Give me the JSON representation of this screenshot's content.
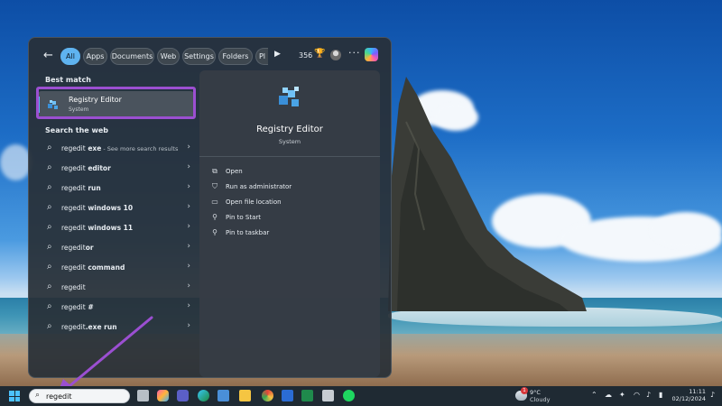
{
  "filter_bar": {
    "chips": [
      "All",
      "Apps",
      "Documents",
      "Web",
      "Settings",
      "Folders",
      "Pl"
    ],
    "active": "All",
    "points": "356"
  },
  "best_match": {
    "heading": "Best match",
    "title": "Registry Editor",
    "subtitle": "System"
  },
  "web": {
    "heading": "Search the web",
    "items": [
      {
        "prefix": "regedit",
        "suffix": " exe",
        "extra": " - See more search results"
      },
      {
        "prefix": "regedit",
        "suffix": " editor",
        "extra": ""
      },
      {
        "prefix": "regedit",
        "suffix": " run",
        "extra": ""
      },
      {
        "prefix": "regedit",
        "suffix": " windows 10",
        "extra": ""
      },
      {
        "prefix": "regedit",
        "suffix": " windows 11",
        "extra": ""
      },
      {
        "prefix": "regedit",
        "suffix": "or",
        "extra": ""
      },
      {
        "prefix": "regedit",
        "suffix": " command",
        "extra": ""
      },
      {
        "prefix": "regedit",
        "suffix": "",
        "extra": ""
      },
      {
        "prefix": "regedit",
        "suffix": " #",
        "extra": ""
      },
      {
        "prefix": "regedit",
        "suffix": ".exe run",
        "extra": ""
      }
    ]
  },
  "preview": {
    "title": "Registry Editor",
    "subtitle": "System",
    "actions": [
      {
        "icon": "open-icon",
        "label": "Open"
      },
      {
        "icon": "admin-shield-icon",
        "label": "Run as administrator"
      },
      {
        "icon": "folder-icon",
        "label": "Open file location"
      },
      {
        "icon": "pin-icon",
        "label": "Pin to Start"
      },
      {
        "icon": "pin-icon",
        "label": "Pin to taskbar"
      }
    ]
  },
  "taskbar": {
    "search_value": "regedit",
    "weather_temp": "9°C",
    "weather_cond": "Cloudy",
    "weather_badge": "1",
    "time": "11:11",
    "date": "02/12/2024"
  },
  "colors": {
    "accent": "#5fb3f0",
    "highlight_box": "#9b4fd1",
    "panel_bg": "#282f37"
  }
}
